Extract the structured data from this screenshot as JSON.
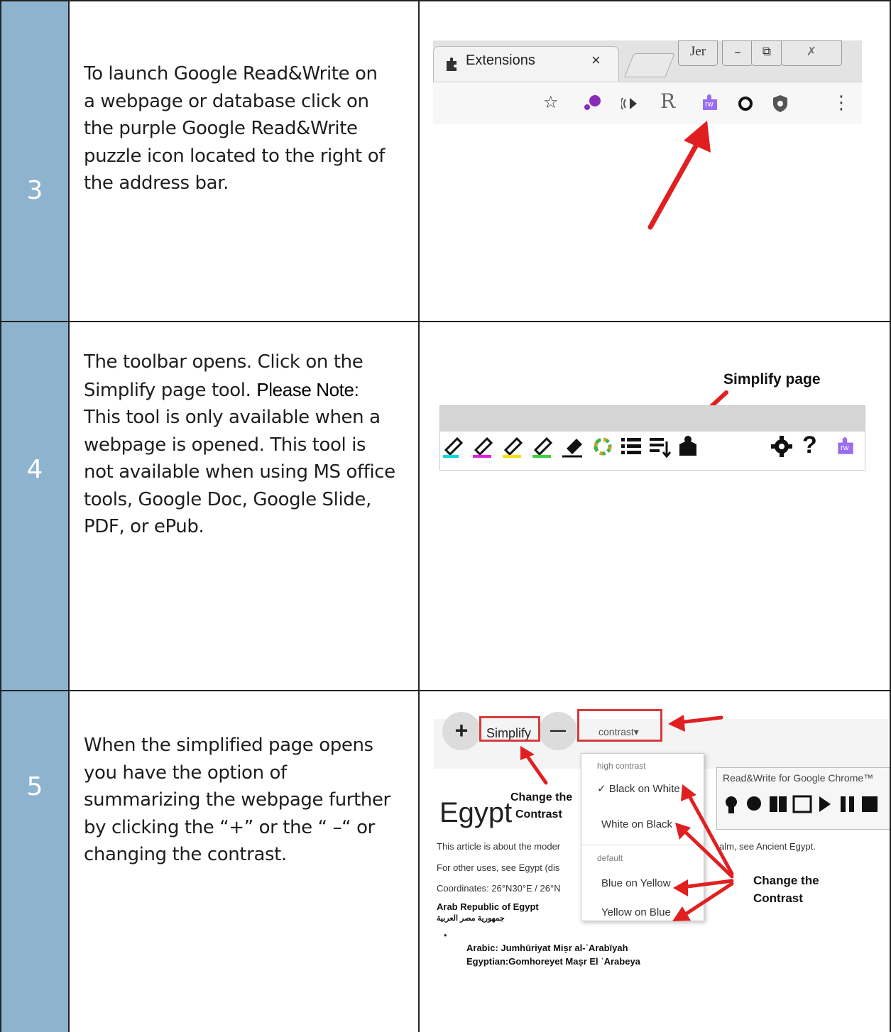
{
  "rows": [
    {
      "num": "3",
      "lines": [
        "To launch Google Read&Write on",
        "a webpage or database click on",
        "the purple Google Read&Write",
        "puzzle icon located to the right of",
        "the address bar."
      ]
    },
    {
      "num": "4",
      "lines": [
        {
          "pre": "The toolbar opens.  Click on the",
          "bold": ""
        },
        {
          "pre": "Simplify page tool.  ",
          "bold": "Please Note:"
        },
        {
          "pre": "This tool is only available when a",
          "bold": ""
        },
        {
          "pre": "webpage is opened.  This tool is",
          "bold": ""
        },
        {
          "pre": "not available when using MS office",
          "bold": ""
        },
        {
          "pre": "tools, Google Doc, Google Slide,",
          "bold": ""
        },
        {
          "pre": "PDF, or ePub.",
          "bold": ""
        }
      ]
    },
    {
      "num": "5",
      "lines": [
        "When the simplified page opens",
        "you have the option of",
        "summarizing the webpage further",
        "by clicking the “+” or the  “ –“ or",
        "changing the contrast."
      ]
    }
  ],
  "browser": {
    "tab_label": "Extensions",
    "tab_close": "×",
    "profile_btn": "Jer",
    "minimize": "–",
    "restore": "⧉",
    "close": "✗",
    "star": "☆",
    "r_icon": "R",
    "rw_icon": "rw",
    "menu_icon": "⋮"
  },
  "toolbar": {
    "simplify_label": "Simplify page",
    "help": "?",
    "rw": "rw"
  },
  "simplify": {
    "plus": "+",
    "simplify_btn": "Simplify",
    "minus": "—",
    "contrast_btn": "contrast▾",
    "menu_header_high": "high contrast",
    "opt_black_on_white": "✓ Black on White",
    "opt_white_on_black": "White on Black",
    "menu_header_default": "default",
    "opt_blue_on_yellow": "Blue on Yellow",
    "opt_yellow_on_blue": "Yellow on Blue",
    "panel_title": "Read&Write for Google Chrome™",
    "callout_1": "Change the",
    "callout_1b": "Contrast",
    "callout_2": "Change the",
    "callout_2b": "Contrast",
    "article_title": "Egypt",
    "article_line1a": "This article is about the moder",
    "article_line1b": "alm, see Ancient Egypt.",
    "article_line2": "For other uses, see Egypt (dis",
    "article_line3": "Coordinates: 26°N30°E / 26°N",
    "article_bold": "Arab Republic of Egypt",
    "article_arabic": "جمهورية مصر العربية",
    "bullet": "•",
    "arabic_line": "Arabic:   Jumhūriyat Miṣr al-ʿArabīyah",
    "egyptian_line": "Egyptian:Gomhoreyet Maṣr El ʿArabeya"
  },
  "colors": {
    "num_bg": "#8db3cf",
    "arrow_red": "#e02020",
    "rw_purple": "#9a6cf0"
  }
}
